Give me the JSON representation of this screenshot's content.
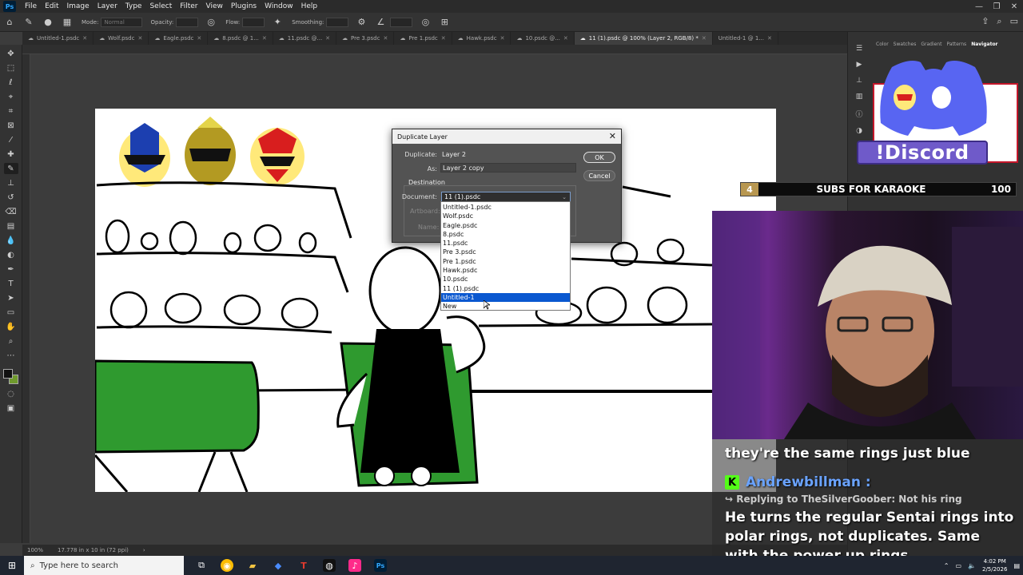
{
  "menubar": {
    "app_icon": "Ps",
    "items": [
      "File",
      "Edit",
      "Image",
      "Layer",
      "Type",
      "Select",
      "Filter",
      "View",
      "Plugins",
      "Window",
      "Help"
    ]
  },
  "options": {
    "mode_label": "Mode:",
    "mode_value": "Normal",
    "opacity_label": "Opacity:",
    "flow_label": "Flow:",
    "smoothing_label": "Smoothing:"
  },
  "tabs": [
    {
      "label": "Untitled-1.psdc",
      "active": false
    },
    {
      "label": "Wolf.psdc",
      "active": false
    },
    {
      "label": "Eagle.psdc",
      "active": false
    },
    {
      "label": "8.psdc @ 1...",
      "active": false
    },
    {
      "label": "11.psdc @...",
      "active": false
    },
    {
      "label": "Pre 3.psdc",
      "active": false
    },
    {
      "label": "Pre 1.psdc",
      "active": false
    },
    {
      "label": "Hawk.psdc",
      "active": false
    },
    {
      "label": "10.psdc @...",
      "active": false
    },
    {
      "label": "11 (1).psdc @ 100% (Layer 2, RGB/8) *",
      "active": true
    },
    {
      "label": "Untitled-1 @ 1...",
      "active": false
    }
  ],
  "status": {
    "zoom": "100%",
    "doc_size": "17.778 in x 10 in (72 ppi)"
  },
  "panels": {
    "tabs": [
      "Color",
      "Swatches",
      "Gradient",
      "Patterns",
      "Navigator"
    ],
    "active_tab": "Navigator"
  },
  "dialog": {
    "title": "Duplicate Layer",
    "duplicate_label": "Duplicate:",
    "duplicate_value": "Layer 2",
    "as_label": "As:",
    "as_value": "Layer 2 copy",
    "destination_label": "Destination",
    "document_label": "Document:",
    "document_value": "11 (1).psdc",
    "artboard_label": "Artboard:",
    "name_label": "Name:",
    "ok_label": "OK",
    "cancel_label": "Cancel",
    "dropdown_options": [
      "Untitled-1.psdc",
      "Wolf.psdc",
      "Eagle.psdc",
      "8.psdc",
      "11.psdc",
      "Pre 3.psdc",
      "Pre 1.psdc",
      "Hawk.psdc",
      "10.psdc",
      "11 (1).psdc",
      "Untitled-1",
      "New"
    ],
    "highlighted_option": "Untitled-1"
  },
  "overlay": {
    "discord_text": "!Discord",
    "subs_count": "4",
    "subs_text": "SUBS FOR KARAOKE",
    "subs_goal": "100",
    "chat_line": "they're the same rings just blue",
    "chat_badge": "K",
    "chat_username": "Andrewbillman :",
    "chat_reply": "↪ Replying to TheSilverGoober: Not his ring",
    "chat_message": "He turns the regular Sentai rings into polar rings, not duplicates. Same with the power up rings"
  },
  "taskbar": {
    "search_placeholder": "Type here to search",
    "time": "4:02 PM",
    "date": "2/5/2026"
  },
  "colors": {
    "accent_highlight": "#0a58d0",
    "discord_purple": "#6f5ac9",
    "kick_green": "#53fc18",
    "canvas_green": "#2f9a2f"
  }
}
